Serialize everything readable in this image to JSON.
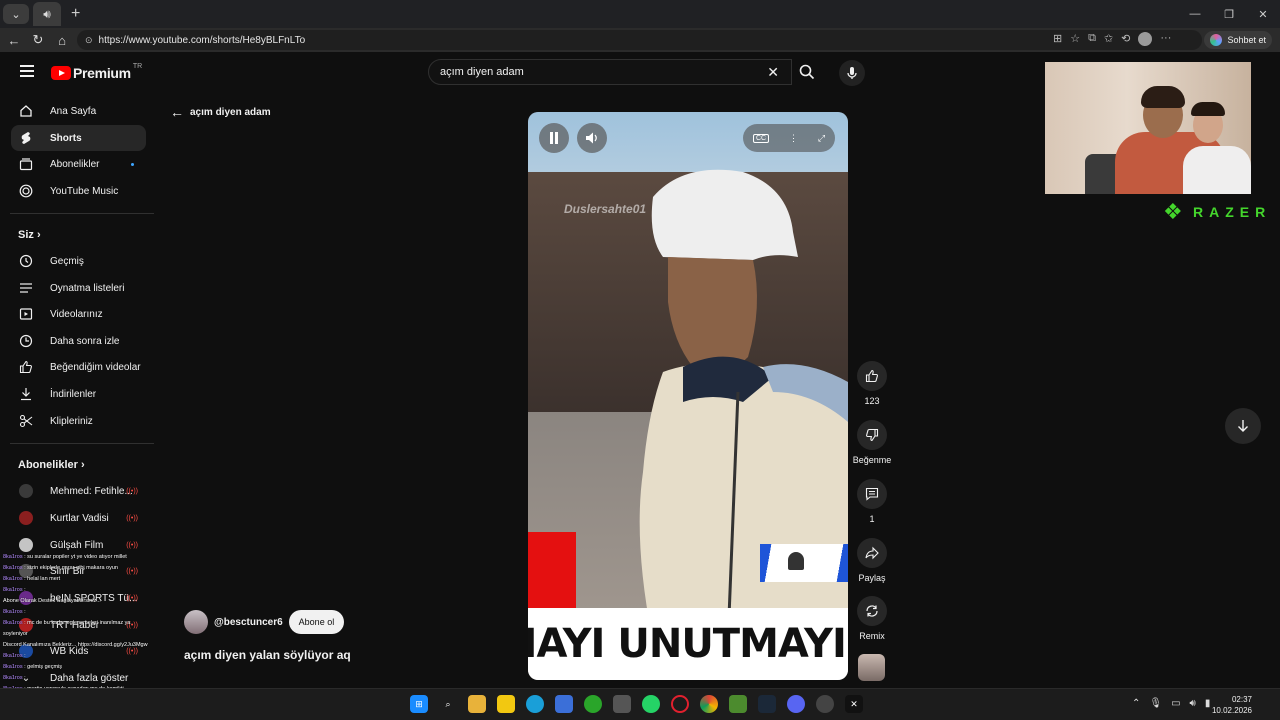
{
  "browser": {
    "url": "https://www.youtube.com/shorts/He8yBLFnLTo",
    "copilot_label": "Sohbet et"
  },
  "header": {
    "logo_text": "Premium",
    "logo_region": "TR",
    "search_value": "açım diyen adam"
  },
  "sidebar": {
    "main": [
      {
        "label": "Ana Sayfa"
      },
      {
        "label": "Shorts"
      },
      {
        "label": "Abonelikler"
      },
      {
        "label": "YouTube Music"
      }
    ],
    "you_heading": "Siz",
    "you_items": [
      {
        "label": "Geçmiş"
      },
      {
        "label": "Oynatma listeleri"
      },
      {
        "label": "Videolarınız"
      },
      {
        "label": "Daha sonra izle"
      },
      {
        "label": "Beğendiğim videolar"
      },
      {
        "label": "İndirilenler"
      },
      {
        "label": "Klipleriniz"
      }
    ],
    "subs_heading": "Abonelikler",
    "subs": [
      {
        "label": "Mehmed: Fetihle...",
        "color": "#3a3a3a"
      },
      {
        "label": "Kurtlar Vadisi",
        "color": "#8a1f1f"
      },
      {
        "label": "Gülşah Film",
        "color": "#c4c4c4"
      },
      {
        "label": "Sinir Bir",
        "color": "#555555"
      },
      {
        "label": "beIN SPORTS Tü...",
        "color": "#6a2a8a"
      },
      {
        "label": "TRT Haber",
        "color": "#b02020"
      },
      {
        "label": "WB Kids",
        "color": "#1a4aa0"
      }
    ],
    "show_more": "Daha fazla göster"
  },
  "chat": [
    {
      "user": "8ka1ros",
      "text": " : su suralar popiler yt ye video atıyor millet"
    },
    {
      "user": "8ka1ros",
      "text": " : sizin ekiplerle garar gibi makara oyun"
    },
    {
      "user": "8ka1ros",
      "text": " : helal lan mert"
    },
    {
      "user": "8ka1ros",
      "text": " :"
    },
    {
      "user": "",
      "text": "Abone Olarak Destek Sağlayabilirsiniz..."
    },
    {
      "user": "8ka1ros",
      "text": " :"
    },
    {
      "user": "8ka1ros",
      "text": " : mc de bu kadar eglenemeleri inanılmaz ya"
    },
    {
      "user": "",
      "text": "soyleniyor"
    },
    {
      "user": "",
      "text": "Discord Kanalımıza Bekleriz... https://discord.gg/y2Ju3Mgw"
    },
    {
      "user": "8ka1ros",
      "text": " :"
    },
    {
      "user": "8ka1ros",
      "text": " : gelmiş geçmiş"
    },
    {
      "user": "8ka1ros",
      "text": " :"
    },
    {
      "user": "8ka1ros",
      "text": " : mertin yengeyle oynadıgı mc de komikti"
    },
    {
      "user": "8ka1ros",
      "text": " :"
    }
  ],
  "short": {
    "back_label": "açım diyen adam",
    "watermark": "Duslersahte01",
    "caption": "MAYI UNUTMAYIN",
    "likes": "123",
    "dislike_label": "Beğenme",
    "comments": "1",
    "share_label": "Paylaş",
    "remix_label": "Remix",
    "channel": "@besctuncer6",
    "subscribe_label": "Abone ol",
    "title": "açım diyen yalan söylüyor aq"
  },
  "overlay": {
    "razer_text": "RAZER"
  },
  "taskbar": {
    "time": "02:37",
    "date": "10.02.2026"
  }
}
